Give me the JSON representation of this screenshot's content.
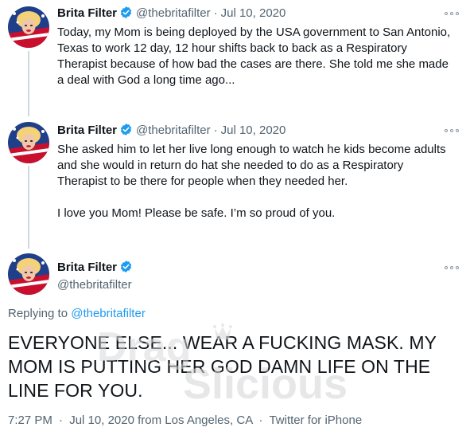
{
  "thread": [
    {
      "name": "Brita Filter",
      "handle": "@thebritafilter",
      "separator": "·",
      "date": "Jul 10, 2020",
      "text": "Today, my Mom is being deployed by the USA government to San Antonio,\nTexas to work 12 day, 12 hour shifts back to back as a Respiratory\nTherapist because of how bad the cases are there. She told me she made\na deal with God a long time ago..."
    },
    {
      "name": "Brita Filter",
      "handle": "@thebritafilter",
      "separator": "·",
      "date": "Jul 10, 2020",
      "text": "She asked him to let her live long enough to watch he kids become adults\nand she would in return do hat she needed to do as a Respiratory\nTherapist to be there for people when they needed her.\n\nI love you Mom! Please be safe. I’m so proud of you."
    }
  ],
  "main_tweet": {
    "name": "Brita Filter",
    "handle": "@thebritafilter",
    "replying_label": "Replying to ",
    "replying_to": "@thebritafilter",
    "text": "EVERYONE ELSE... WEAR A FUCKING MASK. MY MOM IS PUTTING HER GOD DAMN LIFE ON THE LINE FOR YOU.",
    "time": "7:27 PM",
    "date": "Jul 10, 2020",
    "location": "from Los Angeles, CA",
    "client": "Twitter for iPhone",
    "separator": "·"
  },
  "watermark": "DragSlicious",
  "icons": {
    "verified": "verified-badge-icon",
    "more": "more-options-icon"
  },
  "colors": {
    "verified": "#1d9bf0",
    "link": "#1d9bf0",
    "secondary_text": "#536471",
    "thread_line": "#cfd9de"
  }
}
